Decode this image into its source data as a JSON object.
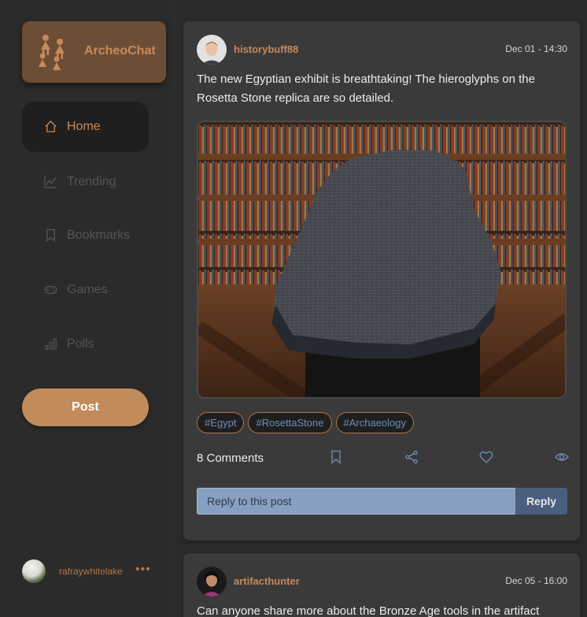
{
  "app": {
    "name": "ArcheoChat",
    "accent": "#c9895a",
    "nav": [
      {
        "id": "home",
        "label": "Home",
        "icon": "home-icon",
        "active": true
      },
      {
        "id": "trending",
        "label": "Trending",
        "icon": "trending-icon",
        "active": false
      },
      {
        "id": "bookmarks",
        "label": "Bookmarks",
        "icon": "bookmark-icon",
        "active": false
      },
      {
        "id": "games",
        "label": "Games",
        "icon": "gamepad-icon",
        "active": false
      },
      {
        "id": "polls",
        "label": "Polls",
        "icon": "bar-chart-icon",
        "active": false
      }
    ],
    "post_button": "Post",
    "current_user": {
      "name": "rafraywhitelake",
      "more": "•••"
    }
  },
  "posts": [
    {
      "author": "historybuff88",
      "time": "Dec 01 - 14:30",
      "text": "The new Egyptian exhibit is breathtaking! The hieroglyphs on the Rosetta Stone replica are so detailed.",
      "image": "rosetta-stone-photo",
      "tags": [
        "#Egypt",
        "#RosettaStone",
        "#Archaeology"
      ],
      "comments": "8 Comments",
      "reply_placeholder": "Reply to this post",
      "reply_button": "Reply"
    },
    {
      "author": "artifacthunter",
      "time": "Dec 05 - 16:00",
      "text": "Can anyone share more about the Bronze Age tools in the artifact"
    }
  ]
}
